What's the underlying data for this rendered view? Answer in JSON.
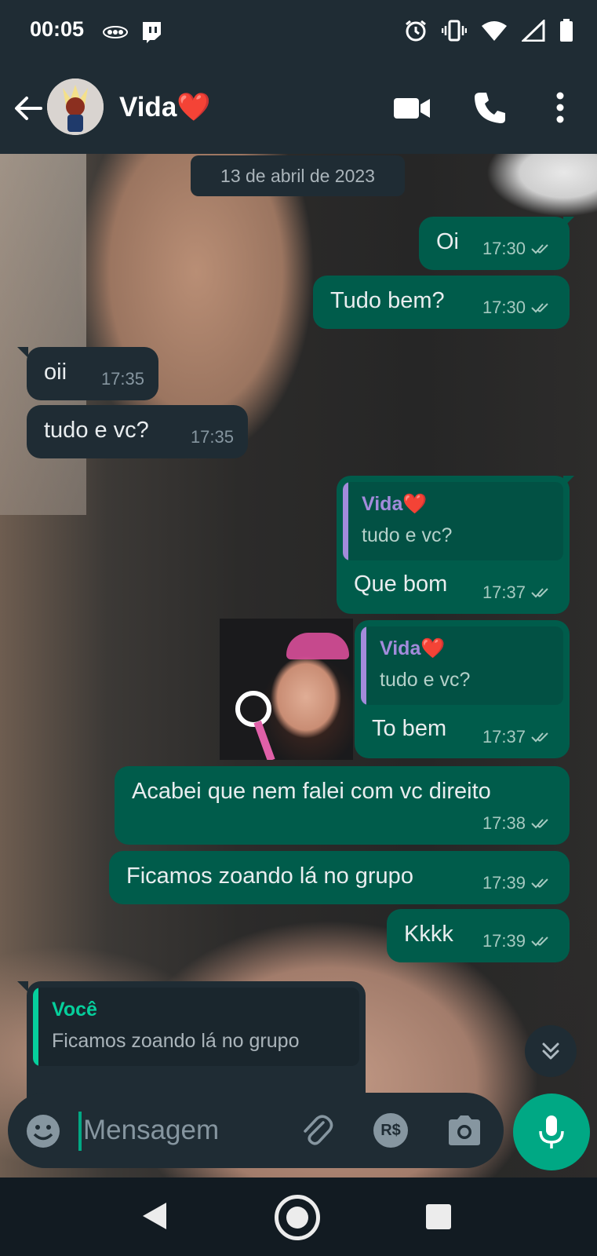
{
  "status_bar": {
    "time": "00:05",
    "left_icons": [
      "eco-icon",
      "twitch-icon"
    ],
    "right_icons": [
      "alarm-icon",
      "vibrate-icon",
      "wifi-icon",
      "signal-icon",
      "battery-icon"
    ]
  },
  "header": {
    "contact_name": "Vida❤️",
    "actions": [
      "video-call-icon",
      "voice-call-icon",
      "more-vert-icon"
    ]
  },
  "chat": {
    "date_chip": "13 de abril de 2023",
    "messages": [
      {
        "direction": "out",
        "text": "Oi",
        "time": "17:30",
        "status": "read"
      },
      {
        "direction": "out",
        "text": "Tudo bem?",
        "time": "17:30",
        "status": "read"
      },
      {
        "direction": "in",
        "text": "oii",
        "time": "17:35"
      },
      {
        "direction": "in",
        "text": "tudo e vc?",
        "time": "17:35"
      },
      {
        "direction": "out",
        "quote": {
          "name": "Vida❤️",
          "text": "tudo e vc?"
        },
        "text": "Que bom",
        "time": "17:37",
        "status": "read"
      },
      {
        "direction": "out",
        "quote": {
          "name": "Vida❤️",
          "text": "tudo e vc?"
        },
        "text": "To bem",
        "time": "17:37",
        "status": "read"
      },
      {
        "direction": "out",
        "text": "Acabei que nem falei com vc direito",
        "time": "17:38",
        "status": "read"
      },
      {
        "direction": "out",
        "text": "Ficamos zoando lá no grupo",
        "time": "17:39",
        "status": "read"
      },
      {
        "direction": "out",
        "text": "Kkkk",
        "time": "17:39",
        "status": "read"
      },
      {
        "direction": "in",
        "quote": {
          "name": "Você",
          "text": "Ficamos zoando lá no grupo"
        },
        "text": "",
        "time": ""
      }
    ]
  },
  "composer": {
    "placeholder": "Mensagem",
    "payment_label": "R$",
    "icons": [
      "emoji-icon",
      "attach-icon",
      "payment-icon",
      "camera-icon",
      "mic-icon"
    ]
  },
  "colors": {
    "outgoing_bubble": "#005c4b",
    "incoming_bubble": "#1f2c34",
    "accent": "#00a884",
    "quote_name_purple": "#a38bdb"
  }
}
